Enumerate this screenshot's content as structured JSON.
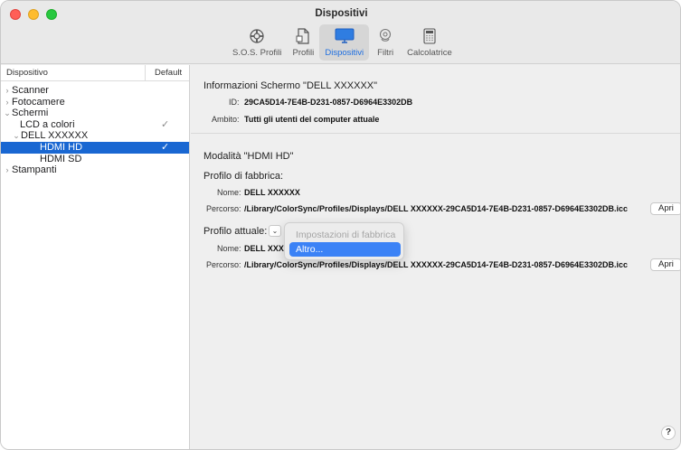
{
  "window": {
    "title": "Dispositivi"
  },
  "toolbar": {
    "items": [
      {
        "label": "S.O.S. Profili",
        "icon": "lifebuoy-icon"
      },
      {
        "label": "Profili",
        "icon": "document-icon"
      },
      {
        "label": "Dispositivi",
        "icon": "display-icon"
      },
      {
        "label": "Filtri",
        "icon": "filter-icon"
      },
      {
        "label": "Calcolatrice",
        "icon": "calculator-icon"
      }
    ]
  },
  "sidebar": {
    "header": {
      "col1": "Dispositivo",
      "col2": "Default"
    },
    "items": [
      {
        "label": "Scanner",
        "tri": "›"
      },
      {
        "label": "Fotocamere",
        "tri": "›"
      },
      {
        "label": "Schermi",
        "tri": "⌄"
      },
      {
        "label": "LCD a colori",
        "check": "✓"
      },
      {
        "label": "DELL XXXXXX",
        "tri": "⌄"
      },
      {
        "label": "HDMI HD",
        "check": "✓"
      },
      {
        "label": "HDMI SD"
      },
      {
        "label": "Stampanti",
        "tri": "›"
      }
    ]
  },
  "info": {
    "title": "Informazioni Schermo \"DELL XXXXXX\"",
    "id_label": "ID:",
    "id_value": "29CA5D14-7E4B-D231-0857-D6964E3302DB",
    "scope_label": "Ambito:",
    "scope_value": "Tutti gli utenti del computer attuale"
  },
  "mode": {
    "title": "Modalità \"HDMI HD\"",
    "factory_title": "Profilo di fabbrica:",
    "name_label": "Nome:",
    "factory_name": "DELL XXXXXX",
    "path_label": "Percorso:",
    "factory_path": "/Library/ColorSync/Profiles/Displays/DELL XXXXXX-29CA5D14-7E4B-D231-0857-D6964E3302DB.icc",
    "open_label": "Apri",
    "current_title": "Profilo attuale:",
    "current_name": "DELL XXXX",
    "current_path": "/Library/ColorSync/Profiles/Displays/DELL XXXXXX-29CA5D14-7E4B-D231-0857-D6964E3302DB.icc"
  },
  "popup_menu": {
    "items": [
      {
        "label": "Impostazioni di fabbrica",
        "enabled": false
      },
      {
        "label": "Altro...",
        "highlighted": true
      }
    ]
  },
  "help_label": "?",
  "colors": {
    "accent": "#1967d2",
    "highlight": "#3b82f6",
    "active_toolbar_text": "#1f6fe0"
  }
}
